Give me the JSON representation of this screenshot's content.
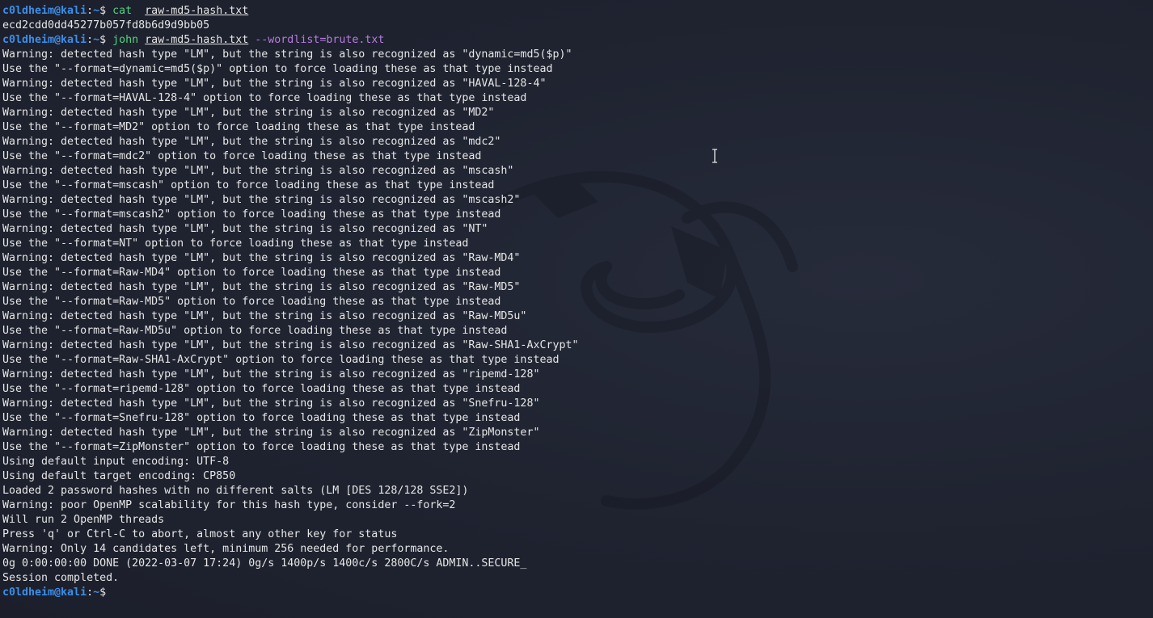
{
  "prompt": {
    "user": "c0ldheim@kali",
    "sep": ":",
    "path": "~",
    "dollar": "$ "
  },
  "cmd1": {
    "command": "cat",
    "space": "  ",
    "arg": "raw-md5-hash.txt"
  },
  "hash_output": "ecd2cdd0dd45277b057fd8b6d9d9bb05",
  "cmd2": {
    "command": "john",
    "arg": "raw-md5-hash.txt",
    "option": "--wordlist=brute.txt"
  },
  "output_lines": [
    "Warning: detected hash type \"LM\", but the string is also recognized as \"dynamic=md5($p)\"",
    "Use the \"--format=dynamic=md5($p)\" option to force loading these as that type instead",
    "Warning: detected hash type \"LM\", but the string is also recognized as \"HAVAL-128-4\"",
    "Use the \"--format=HAVAL-128-4\" option to force loading these as that type instead",
    "Warning: detected hash type \"LM\", but the string is also recognized as \"MD2\"",
    "Use the \"--format=MD2\" option to force loading these as that type instead",
    "Warning: detected hash type \"LM\", but the string is also recognized as \"mdc2\"",
    "Use the \"--format=mdc2\" option to force loading these as that type instead",
    "Warning: detected hash type \"LM\", but the string is also recognized as \"mscash\"",
    "Use the \"--format=mscash\" option to force loading these as that type instead",
    "Warning: detected hash type \"LM\", but the string is also recognized as \"mscash2\"",
    "Use the \"--format=mscash2\" option to force loading these as that type instead",
    "Warning: detected hash type \"LM\", but the string is also recognized as \"NT\"",
    "Use the \"--format=NT\" option to force loading these as that type instead",
    "Warning: detected hash type \"LM\", but the string is also recognized as \"Raw-MD4\"",
    "Use the \"--format=Raw-MD4\" option to force loading these as that type instead",
    "Warning: detected hash type \"LM\", but the string is also recognized as \"Raw-MD5\"",
    "Use the \"--format=Raw-MD5\" option to force loading these as that type instead",
    "Warning: detected hash type \"LM\", but the string is also recognized as \"Raw-MD5u\"",
    "Use the \"--format=Raw-MD5u\" option to force loading these as that type instead",
    "Warning: detected hash type \"LM\", but the string is also recognized as \"Raw-SHA1-AxCrypt\"",
    "Use the \"--format=Raw-SHA1-AxCrypt\" option to force loading these as that type instead",
    "Warning: detected hash type \"LM\", but the string is also recognized as \"ripemd-128\"",
    "Use the \"--format=ripemd-128\" option to force loading these as that type instead",
    "Warning: detected hash type \"LM\", but the string is also recognized as \"Snefru-128\"",
    "Use the \"--format=Snefru-128\" option to force loading these as that type instead",
    "Warning: detected hash type \"LM\", but the string is also recognized as \"ZipMonster\"",
    "Use the \"--format=ZipMonster\" option to force loading these as that type instead",
    "Using default input encoding: UTF-8",
    "Using default target encoding: CP850",
    "Loaded 2 password hashes with no different salts (LM [DES 128/128 SSE2])",
    "Warning: poor OpenMP scalability for this hash type, consider --fork=2",
    "Will run 2 OpenMP threads",
    "Press 'q' or Ctrl-C to abort, almost any other key for status",
    "Warning: Only 14 candidates left, minimum 256 needed for performance.",
    "0g 0:00:00:00 DONE (2022-03-07 17:24) 0g/s 1400p/s 1400c/s 2800C/s ADMIN..SECURE_",
    "Session completed."
  ],
  "colors": {
    "background": "#1f2330",
    "prompt": "#3b8eea",
    "command": "#4fd57f",
    "option": "#b67bde",
    "text": "#e6e6e6"
  },
  "icons": [
    "kali-dragon-watermark",
    "text-cursor-icon"
  ]
}
